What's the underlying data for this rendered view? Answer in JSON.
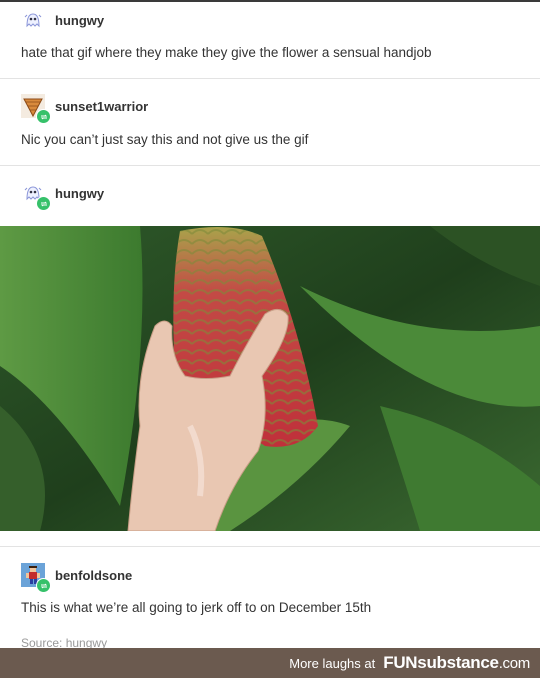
{
  "posts": [
    {
      "username": "hungwy",
      "text": "hate that gif where they make they give the flower a sensual handjob",
      "avatar_icon": "ghost-icon"
    },
    {
      "username": "sunset1warrior",
      "text": "Nic you can’t just say this and not give us the gif",
      "avatar_icon": "ice-cream-cone-icon"
    },
    {
      "username": "hungwy",
      "avatar_icon": "ghost-icon"
    },
    {
      "username": "benfoldsone",
      "text": "This is what we’re all going to jerk off to on December 15th",
      "avatar_icon": "pixel-character-icon"
    }
  ],
  "source": {
    "label": "Source:",
    "name": "hungwy"
  },
  "footer": {
    "more_text": "More laughs at",
    "brand_main": "FUNsubstance",
    "brand_tld": ".com"
  },
  "colors": {
    "reblog_badge": "#36c16a",
    "footer_bg": "#6b5a4f"
  }
}
